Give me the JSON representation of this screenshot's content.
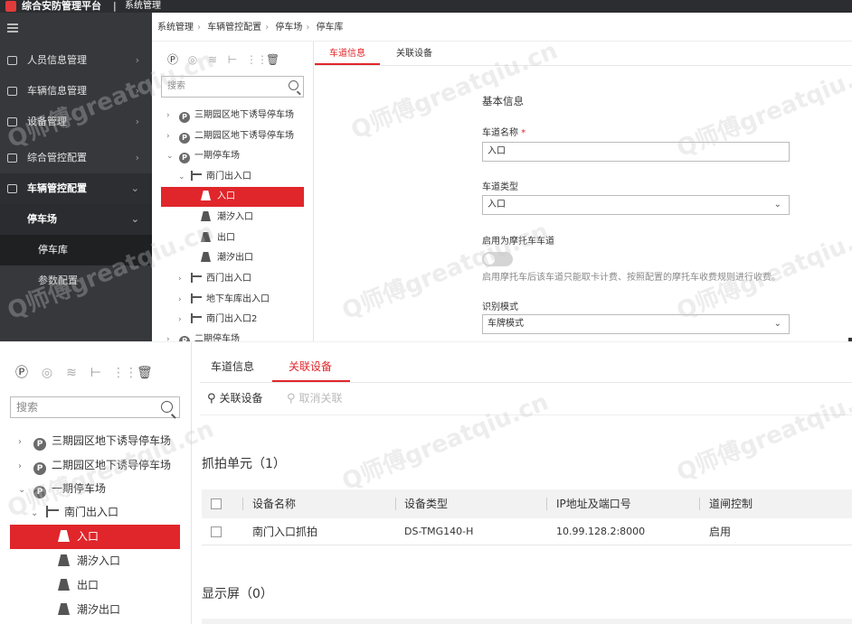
{
  "app": {
    "title": "综合安防管理平台",
    "separator": "|",
    "module": "系统管理"
  },
  "sidebar": {
    "items": [
      {
        "label": "人员信息管理",
        "chevron": "›"
      },
      {
        "label": "车辆信息管理",
        "chevron": "›"
      },
      {
        "label": "设备管理",
        "chevron": "›"
      },
      {
        "label": "综合管控配置",
        "chevron": "›"
      },
      {
        "label": "车辆管控配置",
        "chevron": "⌄"
      }
    ],
    "sub": {
      "label": "停车场",
      "chevron": "⌄"
    },
    "sub2": {
      "label": "停车库"
    },
    "sub3": {
      "label": "参数配置"
    }
  },
  "breadcrumb": [
    "系统管理",
    "车辆管控配置",
    "停车场",
    "停车库"
  ],
  "tree": {
    "search_placeholder": "搜索",
    "toolbar": [
      "Ⓟ",
      "◎",
      "≋",
      "⊢",
      "⋮⋮",
      "🗑"
    ],
    "nodes_top": [
      {
        "label": "三期园区地下诱导停车场",
        "caret": "›",
        "icon": "P"
      },
      {
        "label": "二期园区地下诱导停车场",
        "caret": "›",
        "icon": "P"
      },
      {
        "label": "一期停车场",
        "caret": "⌄",
        "icon": "P"
      },
      {
        "label": "南门出入口",
        "caret": "⌄",
        "icon": "gate"
      },
      {
        "label": "入口",
        "icon": "lane"
      },
      {
        "label": "潮汐入口",
        "icon": "lane"
      },
      {
        "label": "出口",
        "icon": "lane"
      },
      {
        "label": "潮汐出口",
        "icon": "lane"
      },
      {
        "label": "西门出入口",
        "caret": "›",
        "icon": "gate"
      },
      {
        "label": "地下车库出入口",
        "caret": "›",
        "icon": "gate"
      },
      {
        "label": "南门出入口2",
        "caret": "›",
        "icon": "gate"
      },
      {
        "label": "二期停车场",
        "caret": "›",
        "icon": "P"
      }
    ],
    "nodes_bottom": [
      {
        "label": "三期园区地下诱导停车场",
        "caret": "›",
        "icon": "P"
      },
      {
        "label": "二期园区地下诱导停车场",
        "caret": "›",
        "icon": "P"
      },
      {
        "label": "一期停车场",
        "caret": "⌄",
        "icon": "P"
      },
      {
        "label": "南门出入口",
        "caret": "⌄",
        "icon": "gate"
      },
      {
        "label": "入口",
        "icon": "lane"
      },
      {
        "label": "潮汐入口",
        "icon": "lane"
      },
      {
        "label": "出口",
        "icon": "lane"
      },
      {
        "label": "潮汐出口",
        "icon": "lane"
      }
    ]
  },
  "tabs": {
    "lane_info": "车道信息",
    "linked_devices": "关联设备"
  },
  "form": {
    "section": "基本信息",
    "name_label": "车道名称",
    "required": "*",
    "name_value": "入口",
    "type_label": "车道类型",
    "type_value": "入口",
    "moto_label": "启用为摩托车车道",
    "moto_hint": "启用摩托车后该车道只能取卡计费、按照配置的摩托车收费规则进行收费。",
    "mode_label": "识别模式",
    "mode_value": "车牌模式",
    "dropdown_glyph": "⌄"
  },
  "devices": {
    "link_action": "关联设备",
    "unlink_action": "取消关联",
    "capture_title": "抓拍单元（1）",
    "columns": [
      "设备名称",
      "设备类型",
      "IP地址及端口号",
      "道闸控制"
    ],
    "rows": [
      {
        "name": "南门入口抓拍",
        "type": "DS-TMG140-H",
        "ip": "10.99.128.2:8000",
        "gate": "启用"
      }
    ],
    "display_title": "显示屏（0）"
  },
  "watermark": "Q师傅greatqiu.cn",
  "colors": {
    "accent": "#e0262b",
    "sidebar_bg": "#36383c",
    "topbar_bg": "#2b2d30"
  }
}
